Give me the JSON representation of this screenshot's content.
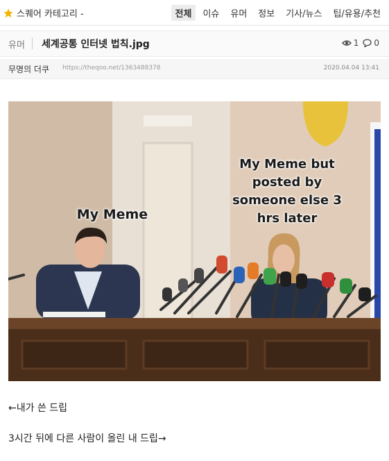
{
  "header": {
    "category_label": "스퀘어 카테고리 -",
    "category_icon": "star-icon",
    "nav": [
      {
        "label": "전체",
        "active": true
      },
      {
        "label": "이슈",
        "active": false
      },
      {
        "label": "유머",
        "active": false
      },
      {
        "label": "정보",
        "active": false
      },
      {
        "label": "기사/뉴스",
        "active": false
      },
      {
        "label": "팁/유용/추천",
        "active": false
      }
    ]
  },
  "post": {
    "board": "유머",
    "title": "세계공통 인터넷 법칙.jpg",
    "views": "1",
    "comments": "0",
    "author": "무명의 더쿠",
    "url": "https://theqoo.net/1363488378",
    "date": "2020.04.04 13:41",
    "image": {
      "caption_left": "My Meme",
      "caption_right": "My Meme but posted by someone else 3 hrs later"
    },
    "body_lines": [
      "←내가 쓴 드립",
      "3시간 뒤에 다른 사람이 올린 내 드립→"
    ]
  },
  "colors": {
    "accent_star": "#f5b400",
    "wall": "#d9c7b5",
    "column": "#e9e2d8",
    "table": "#5b3a22"
  }
}
